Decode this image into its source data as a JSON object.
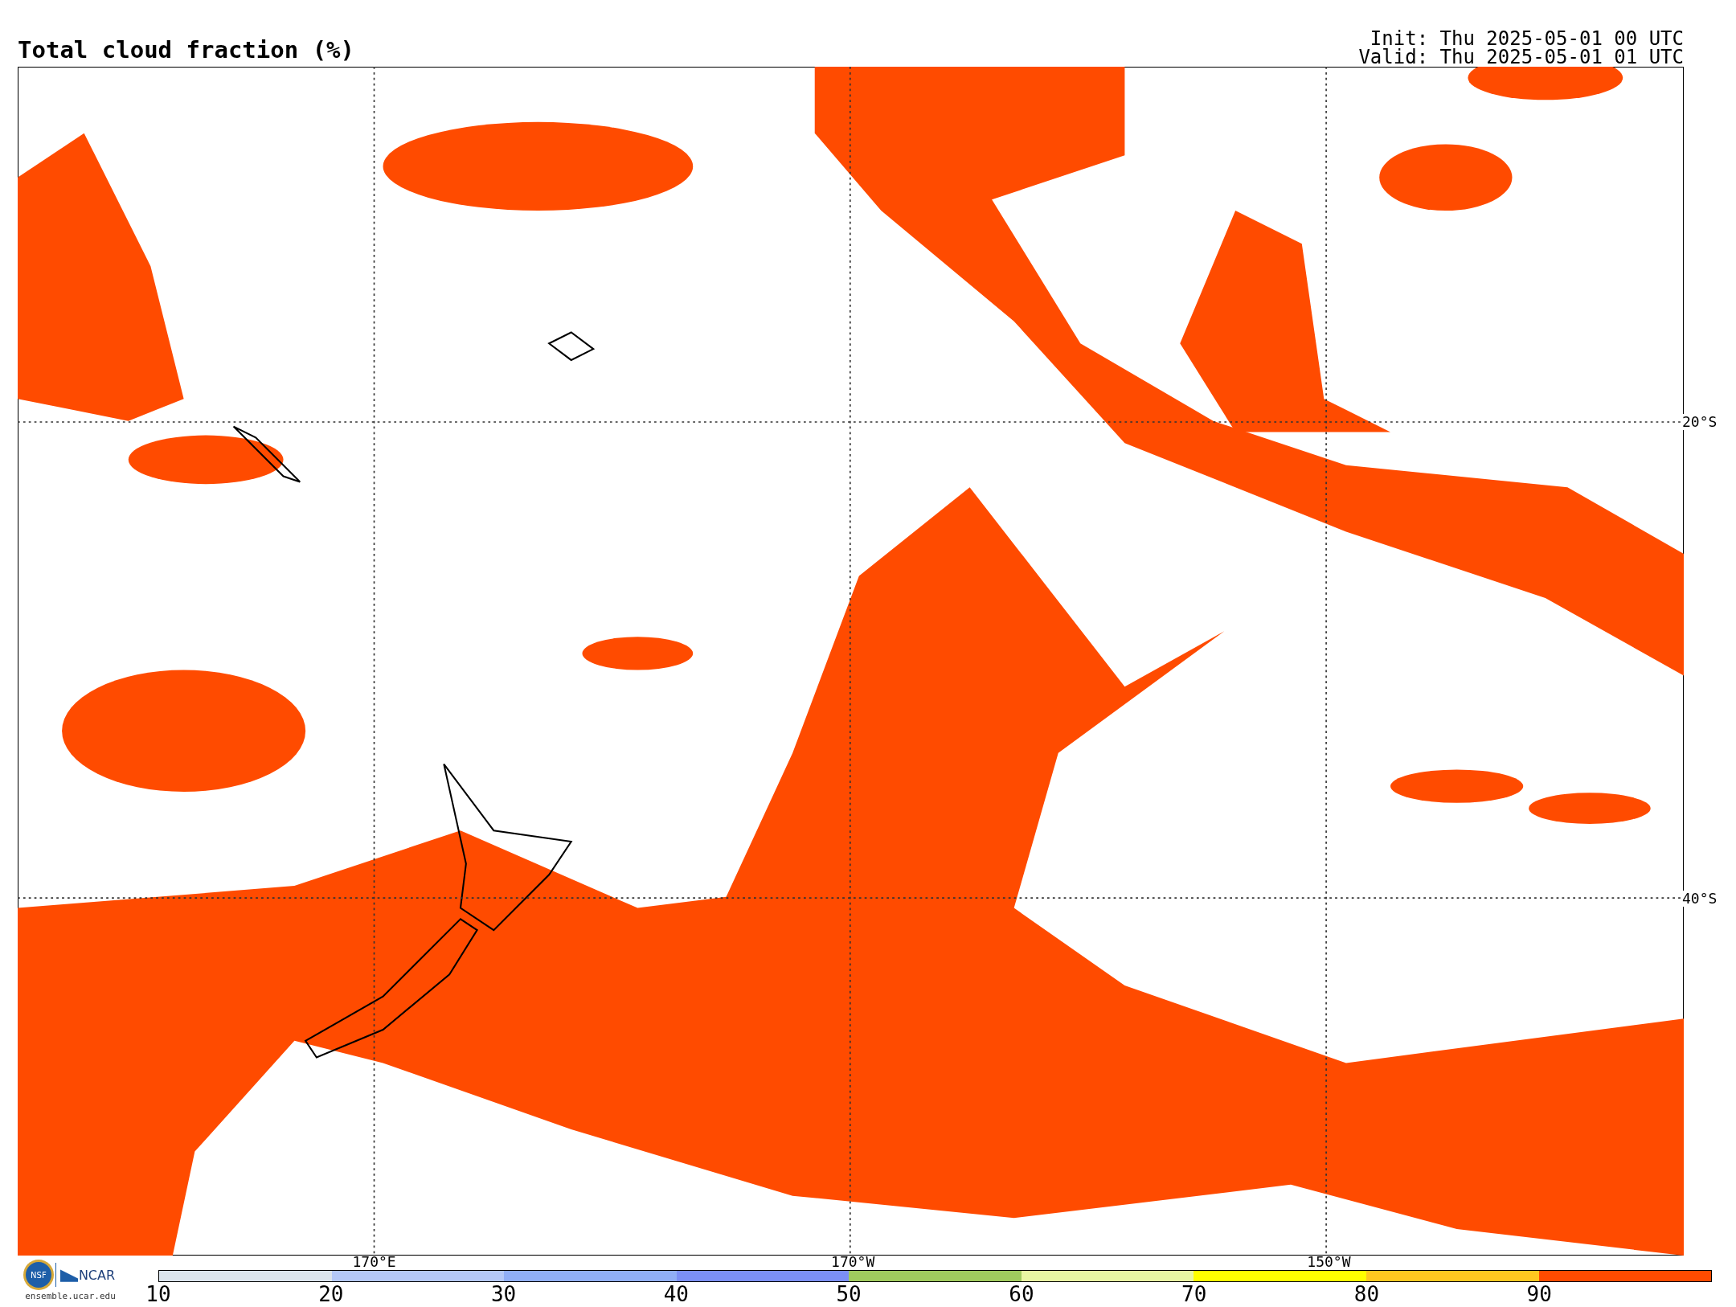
{
  "title": "Total cloud fraction (%)",
  "init": "Init: Thu 2025-05-01 00 UTC",
  "valid": "Valid: Thu 2025-05-01 01 UTC",
  "map": {
    "lat_labels": [
      "20°S",
      "40°S"
    ],
    "lon_labels": [
      "170°E",
      "170°W",
      "150°W"
    ]
  },
  "logo": {
    "nsf": "NSF",
    "ncar": "NCAR",
    "url": "ensemble.ucar.edu"
  },
  "colorbar": [
    {
      "label": "10",
      "color": "#dbe4ec"
    },
    {
      "label": "20",
      "color": "#b4c8f7"
    },
    {
      "label": "30",
      "color": "#90aef6"
    },
    {
      "label": "40",
      "color": "#7b8ff5"
    },
    {
      "label": "50",
      "color": "#a0cb5e"
    },
    {
      "label": "60",
      "color": "#e8f6a2"
    },
    {
      "label": "70",
      "color": "#ffff00"
    },
    {
      "label": "80",
      "color": "#ffc820"
    },
    {
      "label": "90",
      "color": "#ff4b00"
    }
  ]
}
